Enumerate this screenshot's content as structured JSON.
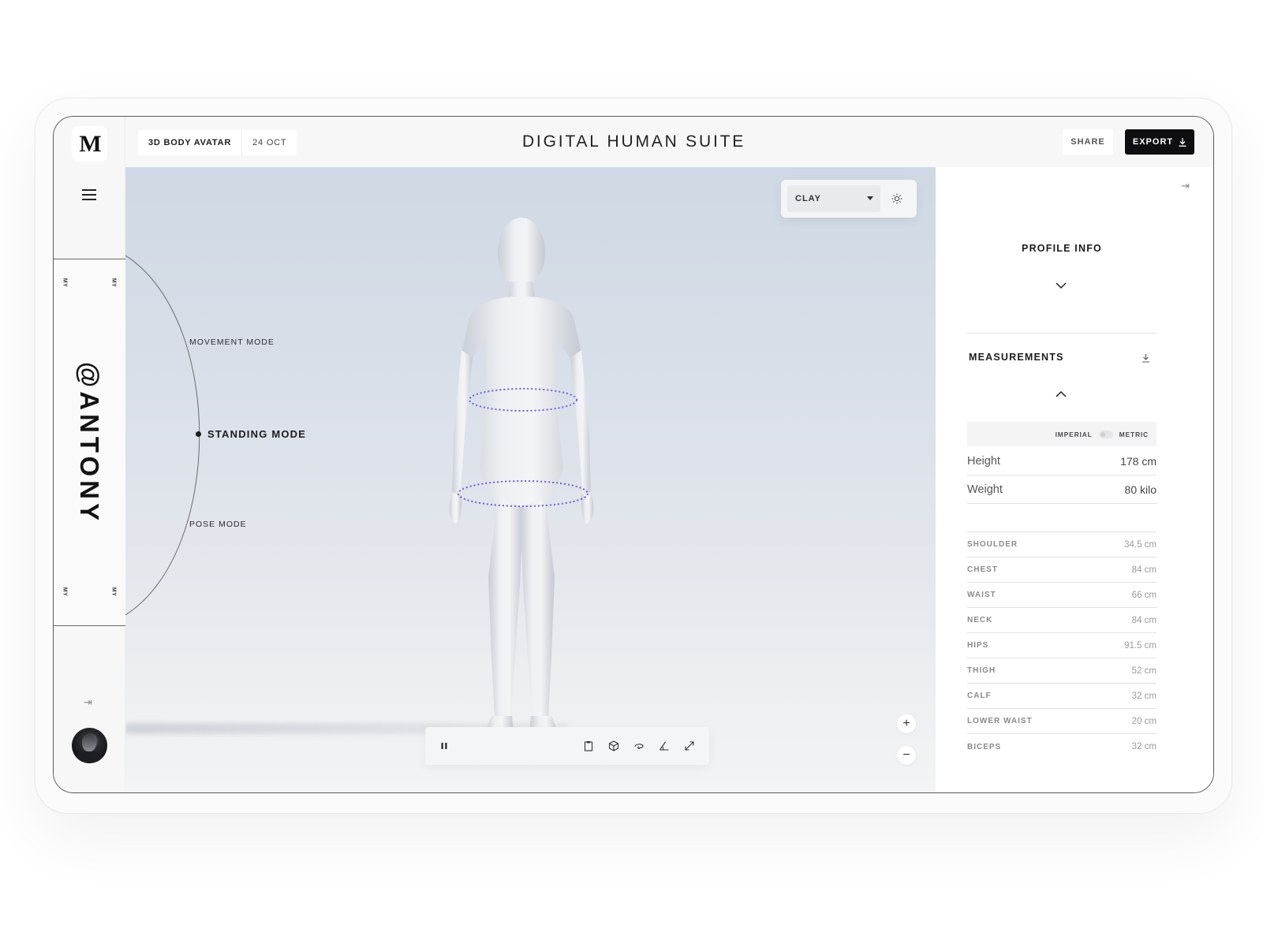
{
  "app": {
    "logo": "M",
    "title": "DIGITAL HUMAN SUITE"
  },
  "breadcrumb": {
    "project": "3D BODY AVATAR",
    "date": "24 OCT"
  },
  "actions": {
    "share": "SHARE",
    "export": "EXPORT"
  },
  "user": {
    "handle": "@ANTONY",
    "tag": "MY"
  },
  "modes": {
    "items": [
      "MOVEMENT MODE",
      "STANDING MODE",
      "POSE MODE"
    ],
    "active": "STANDING MODE"
  },
  "material": {
    "selected": "CLAY"
  },
  "toolbar": {
    "icons": [
      "pause-icon",
      "clipboard-icon",
      "cube-icon",
      "rotate-icon",
      "angle-icon",
      "expand-icon"
    ]
  },
  "zoom": {
    "in": "+",
    "out": "−"
  },
  "profile": {
    "title": "PROFILE INFO"
  },
  "measurements": {
    "title": "MEASUREMENTS",
    "units": {
      "imperial": "IMPERIAL",
      "metric": "METRIC"
    },
    "main": [
      {
        "label": "Height",
        "value": "178 cm"
      },
      {
        "label": "Weight",
        "value": "80 kilo"
      }
    ],
    "list": [
      {
        "label": "SHOULDER",
        "value": "34.5 cm"
      },
      {
        "label": "CHEST",
        "value": "84 cm"
      },
      {
        "label": "WAIST",
        "value": "66 cm"
      },
      {
        "label": "NECK",
        "value": "84 cm"
      },
      {
        "label": "HIPS",
        "value": "91.5 cm"
      },
      {
        "label": "THIGH",
        "value": "52 cm"
      },
      {
        "label": "CALF",
        "value": "32 cm"
      },
      {
        "label": "LOWER WAIST",
        "value": "20 cm"
      },
      {
        "label": "BICEPS",
        "value": "32 cm"
      }
    ]
  },
  "colors": {
    "accent": "#0e0e10",
    "measure_ring": "#6a5fd8",
    "background": "#f7f7f7"
  }
}
